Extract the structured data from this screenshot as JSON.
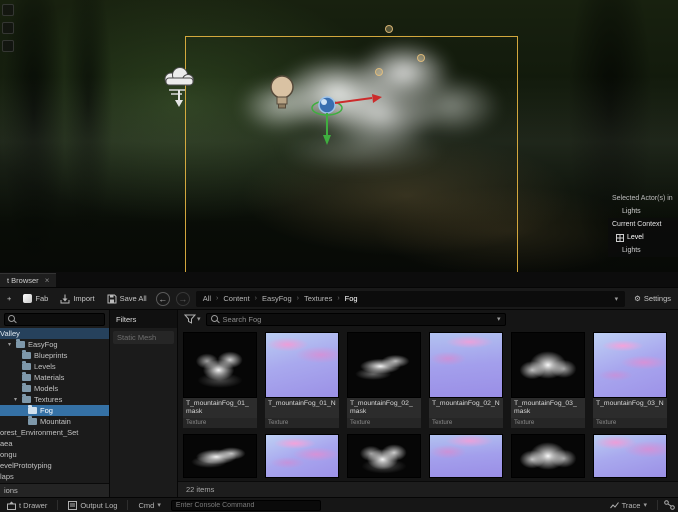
{
  "colors": {
    "accent_blue": "#3571a5",
    "selection_yellow": "#e3b341",
    "ancestor_row_blue": "#26415c",
    "normal_map_base": "#a3a0ec",
    "ui_background": "#151515"
  },
  "icons": {
    "plus": "+",
    "close": "×",
    "gear": "⚙",
    "separator": "›",
    "back": "←",
    "forward": "→",
    "chevron_down": "▾",
    "tree_expanded": "▾"
  },
  "viewport": {
    "overlay": {
      "selected_actors_label": "Selected Actor(s) in",
      "selected_actors_value": "Lights",
      "current_context_label": "Current Context",
      "level_label": "Level",
      "level_value": "Lights"
    }
  },
  "tab_bar": {
    "tab": "t Browser"
  },
  "toolbar": {
    "fab_label": "Fab",
    "import_label": "Import",
    "save_all_label": "Save All",
    "breadcrumb": [
      "All",
      "Content",
      "EasyFog",
      "Textures",
      "Fog"
    ],
    "settings_label": "Settings"
  },
  "sources": {
    "items": [
      {
        "label": "Valley",
        "arrow": "▾"
      },
      {
        "label": "EasyFog",
        "arrow": "▾"
      },
      {
        "label": "Blueprints",
        "arrow": ""
      },
      {
        "label": "Levels",
        "arrow": ""
      },
      {
        "label": "Materials",
        "arrow": ""
      },
      {
        "label": "Models",
        "arrow": ""
      },
      {
        "label": "Textures",
        "arrow": "▾"
      },
      {
        "label": "Fog",
        "arrow": ""
      },
      {
        "label": "Mountain",
        "arrow": ""
      },
      {
        "label": "orest_Environment_Set",
        "arrow": ""
      },
      {
        "label": "aea",
        "arrow": ""
      },
      {
        "label": "ongu",
        "arrow": ""
      },
      {
        "label": "evelPrototyping",
        "arrow": ""
      },
      {
        "label": "laps",
        "arrow": ""
      }
    ],
    "collections_label": "ions"
  },
  "filters": {
    "title": "Filters",
    "items": [
      "Static Mesh"
    ]
  },
  "content": {
    "search_placeholder": "Search Fog",
    "items_count": "22 items",
    "assets": [
      {
        "name": "T_mountainFog_01_mask",
        "type": "Texture"
      },
      {
        "name": "T_mountainFog_01_N",
        "type": "Texture"
      },
      {
        "name": "T_mountainFog_02_mask",
        "type": "Texture"
      },
      {
        "name": "T_mountainFog_02_N",
        "type": "Texture"
      },
      {
        "name": "T_mountainFog_03_mask",
        "type": "Texture"
      },
      {
        "name": "T_mountainFog_03_N",
        "type": "Texture"
      }
    ]
  },
  "status_bar": {
    "content_drawer_label": "t Drawer",
    "output_log_label": "Output Log",
    "cmd_label": "Cmd",
    "console_placeholder": "Enter Console Command",
    "trace_label": "Trace"
  }
}
